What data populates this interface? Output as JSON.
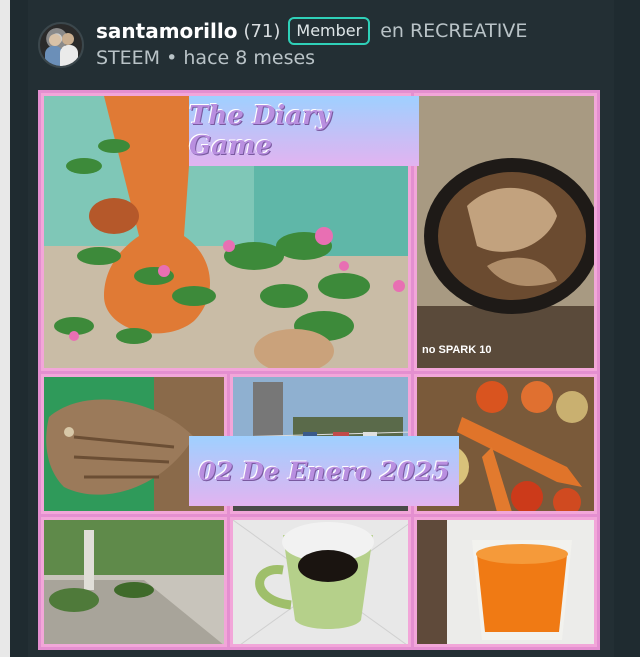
{
  "post": {
    "author": "santamorillo",
    "reputation": "(71)",
    "badge": "Member",
    "preposition": "en",
    "community": "RECREATIVE",
    "community_line2": "STEEM",
    "separator": "•",
    "time_ago": "hace 8 meses"
  },
  "collage": {
    "title": "The Diary Game",
    "date": "02 De Enero 2025",
    "watermark": "no SPARK 10",
    "photos": [
      "potted-plants-icon",
      "frying-fish-pan-icon",
      "dried-fish-icon",
      "laundry-yard-icon",
      "vegetables-icon",
      "garden-path-icon",
      "coffee-cup-icon",
      "orange-juice-cup-icon"
    ]
  },
  "colors": {
    "background": "#1f2b30",
    "badge_border": "#2fd0b8",
    "collage_border": "#e48fd0"
  }
}
